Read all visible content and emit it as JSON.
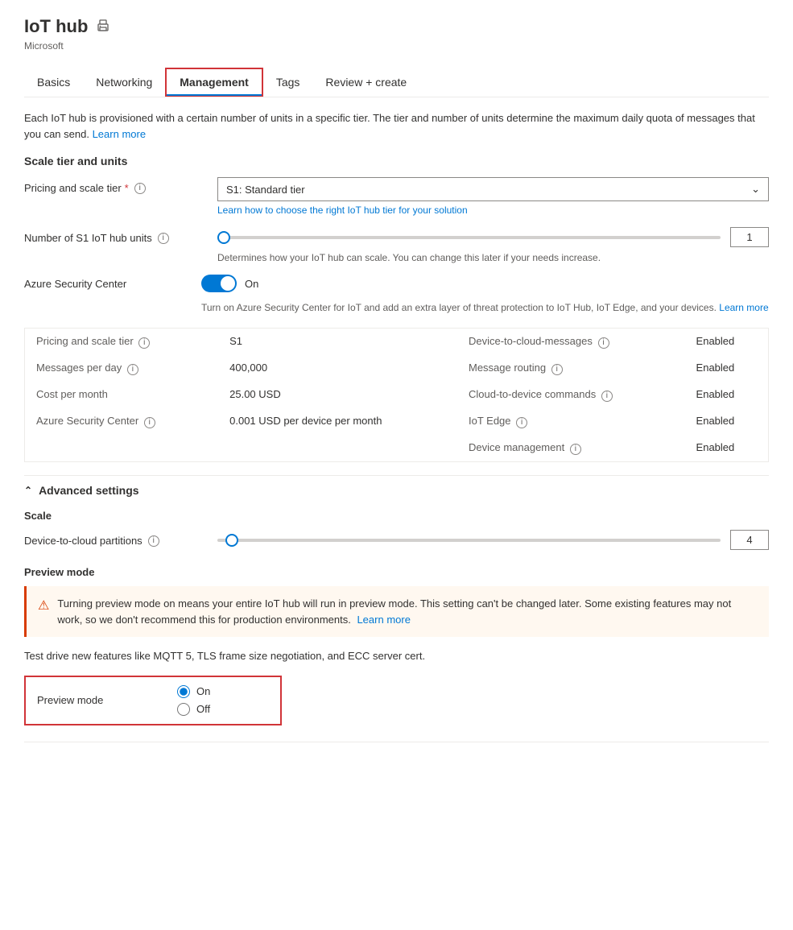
{
  "page": {
    "title": "IoT hub",
    "subtitle": "Microsoft"
  },
  "tabs": [
    {
      "id": "basics",
      "label": "Basics",
      "active": false
    },
    {
      "id": "networking",
      "label": "Networking",
      "active": false
    },
    {
      "id": "management",
      "label": "Management",
      "active": true
    },
    {
      "id": "tags",
      "label": "Tags",
      "active": false
    },
    {
      "id": "review",
      "label": "Review + create",
      "active": false
    }
  ],
  "description": "Each IoT hub is provisioned with a certain number of units in a specific tier. The tier and number of units determine the maximum daily quota of messages that you can send.",
  "description_link": "Learn more",
  "scale_tier_section": "Scale tier and units",
  "pricing_label": "Pricing and scale tier",
  "pricing_required": "*",
  "pricing_info_icon": "i",
  "pricing_value": "S1: Standard tier",
  "pricing_hint": "Learn how to choose the right IoT hub tier for your solution",
  "units_label": "Number of S1 IoT hub units",
  "units_info_icon": "i",
  "units_value": 1,
  "units_hint": "Determines how your IoT hub can scale. You can change this later if your needs increase.",
  "security_label": "Azure Security Center",
  "security_toggle_text": "On",
  "security_description": "Turn on Azure Security Center for IoT and add an extra layer of threat protection to IoT Hub, IoT Edge, and your devices.",
  "security_learn_more": "Learn more",
  "info_table": {
    "rows_left": [
      {
        "key": "Pricing and scale tier",
        "has_info": true,
        "value": "S1"
      },
      {
        "key": "Messages per day",
        "has_info": true,
        "value": "400,000"
      },
      {
        "key": "Cost per month",
        "has_info": false,
        "value": "25.00 USD"
      },
      {
        "key": "Azure Security Center",
        "has_info": true,
        "value": "0.001 USD per device per month"
      }
    ],
    "rows_right": [
      {
        "key": "Device-to-cloud-messages",
        "has_info": true,
        "value": "Enabled"
      },
      {
        "key": "Message routing",
        "has_info": true,
        "value": "Enabled"
      },
      {
        "key": "Cloud-to-device commands",
        "has_info": true,
        "value": "Enabled"
      },
      {
        "key": "IoT Edge",
        "has_info": true,
        "value": "Enabled"
      },
      {
        "key": "Device management",
        "has_info": true,
        "value": "Enabled"
      }
    ]
  },
  "advanced_settings_label": "Advanced settings",
  "scale_label": "Scale",
  "partitions_label": "Device-to-cloud partitions",
  "partitions_info_icon": "i",
  "partitions_value": 4,
  "preview_mode_section": "Preview mode",
  "warning_text": "Turning preview mode on means your entire IoT hub will run in preview mode. This setting can't be changed later. Some existing features may not work, so we don't recommend this for production environments.",
  "warning_learn_more": "Learn more",
  "test_drive_text": "Test drive new features like MQTT 5, TLS frame size negotiation, and ECC server cert.",
  "preview_mode_label": "Preview mode",
  "preview_on_label": "On",
  "preview_off_label": "Off"
}
